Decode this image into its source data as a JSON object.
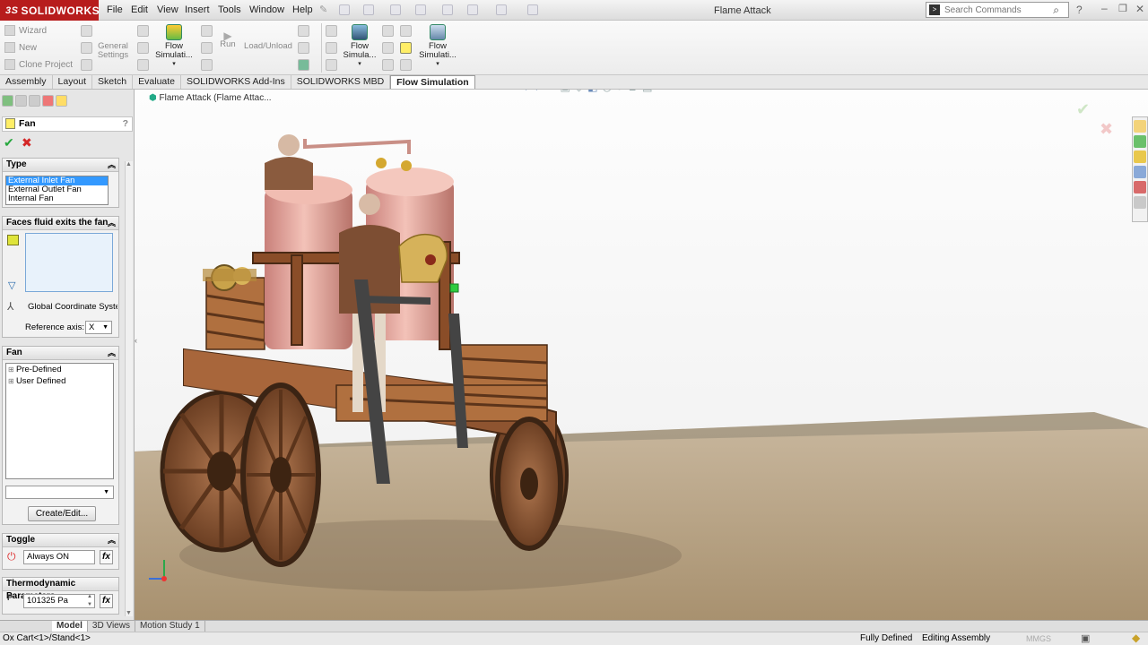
{
  "app": {
    "brand": "SOLIDWORKS",
    "window_title": "Flame Attack"
  },
  "menu": [
    "File",
    "Edit",
    "View",
    "Insert",
    "Tools",
    "Window",
    "Help"
  ],
  "search": {
    "placeholder": "Search Commands"
  },
  "command_manager": {
    "small_left": [
      "Wizard",
      "New",
      "Clone Project"
    ],
    "general_settings": "General Settings",
    "flow_simulation_1": "Flow Simulati...",
    "run": "Run",
    "load_unload": "Load/Unload",
    "flow_simulation_2": "Flow Simula...",
    "flow_simulation_3": "Flow Simulati..."
  },
  "tabs": [
    "Assembly",
    "Layout",
    "Sketch",
    "Evaluate",
    "SOLIDWORKS Add-Ins",
    "SOLIDWORKS MBD",
    "Flow Simulation"
  ],
  "active_tab": "Flow Simulation",
  "tree_breadcrumb": "Flame Attack  (Flame Attac...",
  "panel": {
    "title": "Fan",
    "type_header": "Type",
    "type_options": [
      "External Inlet Fan",
      "External Outlet Fan",
      "Internal Fan"
    ],
    "faces_header": "Faces fluid exits the fan",
    "coordinate_system": "Global Coordinate Syster",
    "reference_axis_label": "Reference axis:",
    "reference_axis_value": "X",
    "fan_header": "Fan",
    "fan_tree": [
      "Pre-Defined",
      "User Defined"
    ],
    "create_edit": "Create/Edit...",
    "toggle_header": "Toggle",
    "toggle_value": "Always ON",
    "thermo_header": "Thermodynamic Parameters",
    "pressure_value": "101325 Pa",
    "fx": "fx"
  },
  "bottom_tabs": [
    "Model",
    "3D Views",
    "Motion Study 1"
  ],
  "active_bottom_tab": "Model",
  "status": {
    "left": "Ox Cart<1>/Stand<1>",
    "defined": "Fully Defined",
    "mode": "Editing Assembly",
    "units": "MMGS"
  },
  "colors": {
    "brand_red": "#b71c1c",
    "selection_blue": "#3399ff",
    "floor": "#b8a58a",
    "copper": "#d99a8e",
    "wood": "#9a5a30"
  }
}
